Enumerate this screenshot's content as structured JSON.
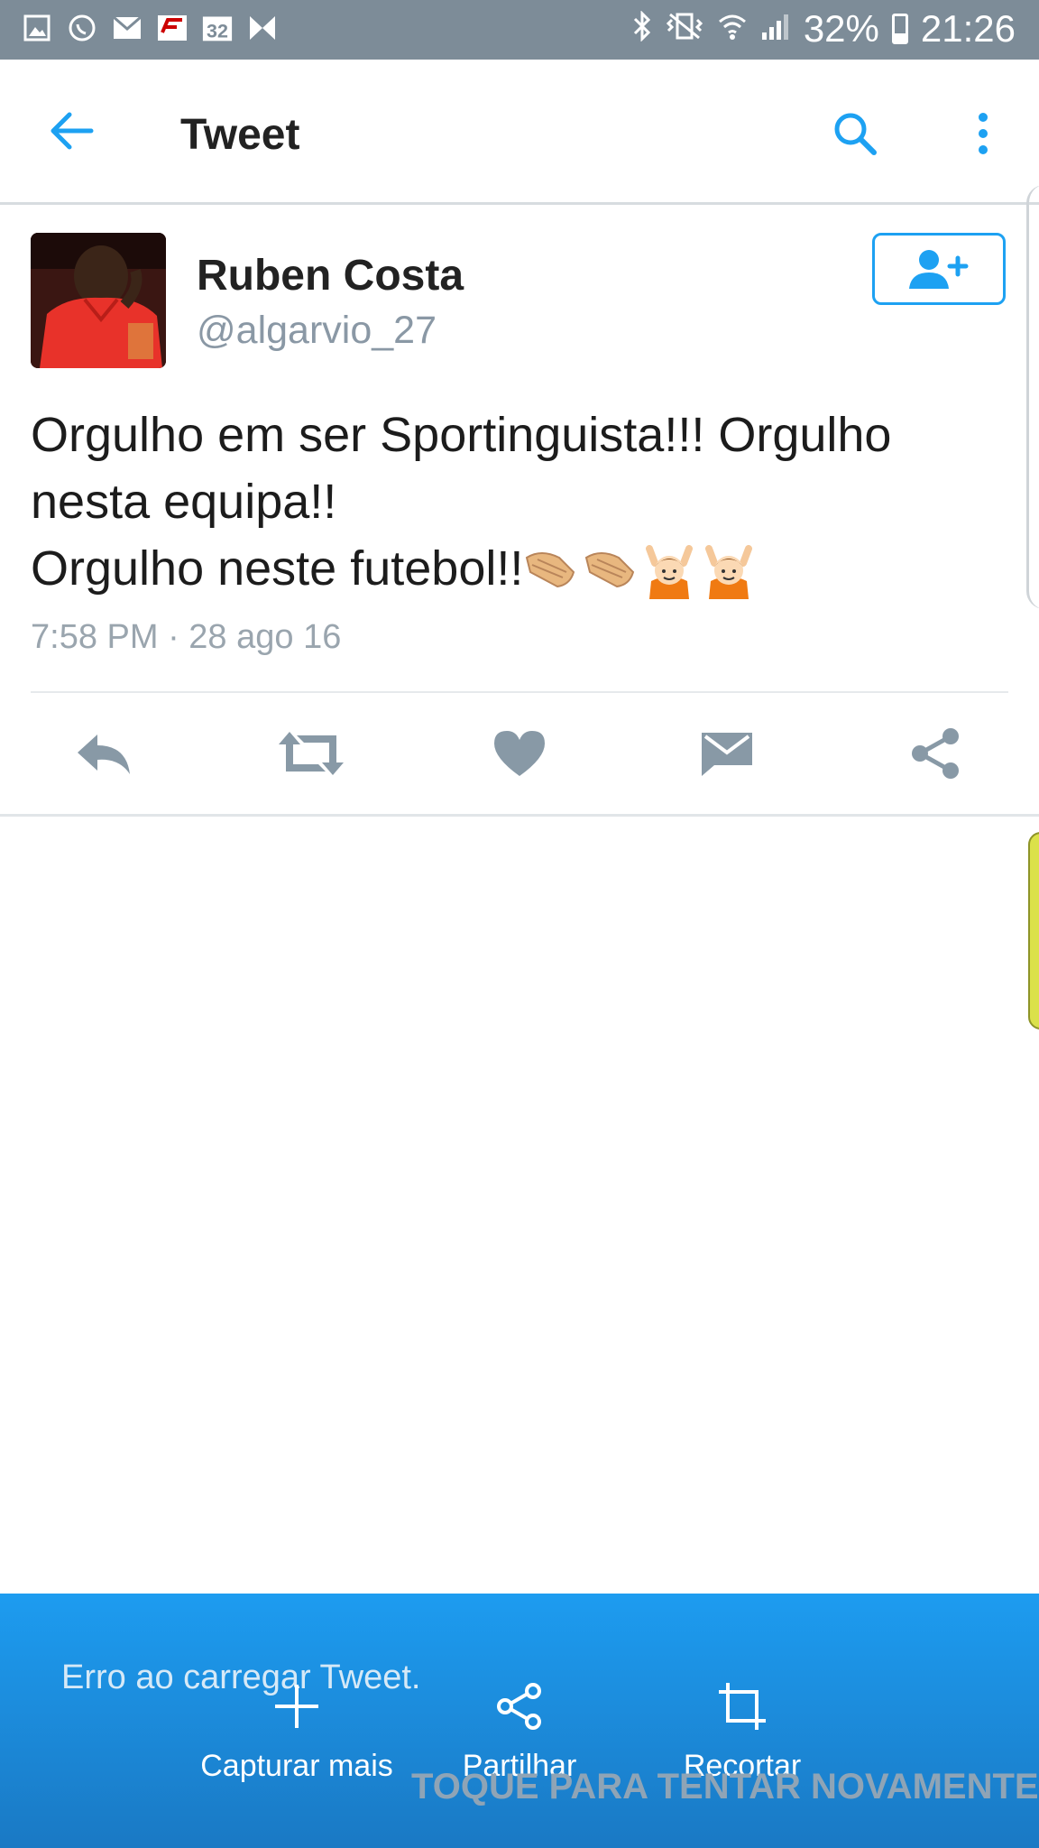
{
  "status_bar": {
    "notification_badge": "32",
    "battery": "32%",
    "time": "21:26",
    "icons": [
      "gallery-icon",
      "whatsapp-icon",
      "mail-icon",
      "f1-icon",
      "calendar-icon",
      "bow-icon",
      "bluetooth-icon",
      "vibrate-icon",
      "wifi-icon",
      "signal-icon"
    ]
  },
  "app_bar": {
    "title": "Tweet",
    "accent_color": "#1da1f2"
  },
  "tweet": {
    "author_name": "Ruben Costa",
    "author_handle": "@algarvio_27",
    "text_line_1": "Orgulho em ser Sportinguista!!! Orgulho",
    "text_line_2": "nesta equipa!!",
    "text_line_3": "Orgulho neste futebol!!",
    "emojis": [
      "clapping-hands",
      "clapping-hands",
      "raising-hands-person",
      "raising-hands-person"
    ],
    "timestamp": "7:58 PM · 28 ago 16"
  },
  "actions": [
    "reply-icon",
    "retweet-icon",
    "like-icon",
    "message-icon",
    "share-icon"
  ],
  "error": {
    "message": "Erro ao carregar Tweet.",
    "retry": "TOQUE PARA TENTAR NOVAMENTE"
  },
  "screenshot_toolbar": {
    "capture_more": "Capturar mais",
    "share": "Partilhar",
    "crop": "Recortar"
  }
}
